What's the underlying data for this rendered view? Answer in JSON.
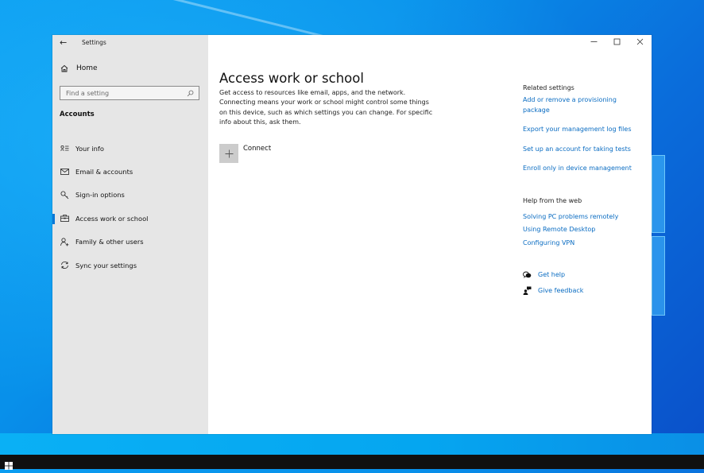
{
  "window": {
    "app_title": "Settings",
    "back_icon": "back-arrow-icon",
    "controls": {
      "minimize_icon": "minimize-icon",
      "maximize_icon": "maximize-icon",
      "close_icon": "close-icon",
      "minimize_glyph": "—",
      "maximize_glyph": "☐",
      "close_glyph": "✕",
      "back_glyph": "←"
    }
  },
  "sidebar": {
    "home_label": "Home",
    "home_icon": "home-icon",
    "search": {
      "placeholder": "Find a setting",
      "value": "",
      "icon": "search-icon"
    },
    "section_title": "Accounts",
    "items": [
      {
        "label": "Your info",
        "icon": "your-info-icon",
        "active": false
      },
      {
        "label": "Email & accounts",
        "icon": "mail-icon",
        "active": false
      },
      {
        "label": "Sign-in options",
        "icon": "key-icon",
        "active": false
      },
      {
        "label": "Access work or school",
        "icon": "briefcase-icon",
        "active": true
      },
      {
        "label": "Family & other users",
        "icon": "add-person-icon",
        "active": false
      },
      {
        "label": "Sync your settings",
        "icon": "sync-icon",
        "active": false
      }
    ]
  },
  "main": {
    "title": "Access work or school",
    "description": "Get access to resources like email, apps, and the network. Connecting means your work or school might control some things on this device, such as which settings you can change. For specific info about this, ask them.",
    "connect": {
      "label": "Connect",
      "icon": "plus-icon",
      "glyph": "+"
    }
  },
  "related_settings": {
    "heading": "Related settings",
    "links": [
      "Add or remove a provisioning package",
      "Export your management log files",
      "Set up an account for taking tests",
      "Enroll only in device management"
    ]
  },
  "help_from_web": {
    "heading": "Help from the web",
    "links": [
      "Solving PC problems remotely",
      "Using Remote Desktop",
      "Configuring VPN"
    ]
  },
  "support": {
    "get_help": {
      "label": "Get help",
      "icon": "help-chat-icon"
    },
    "give_feedback": {
      "label": "Give feedback",
      "icon": "feedback-icon"
    }
  },
  "colors": {
    "accent": "#0a78d7",
    "link": "#0a6cc2",
    "sidebar_bg": "#e6e6e6",
    "taskbar_bg": "#101010"
  },
  "taskbar": {
    "start_icon": "windows-start-icon"
  }
}
